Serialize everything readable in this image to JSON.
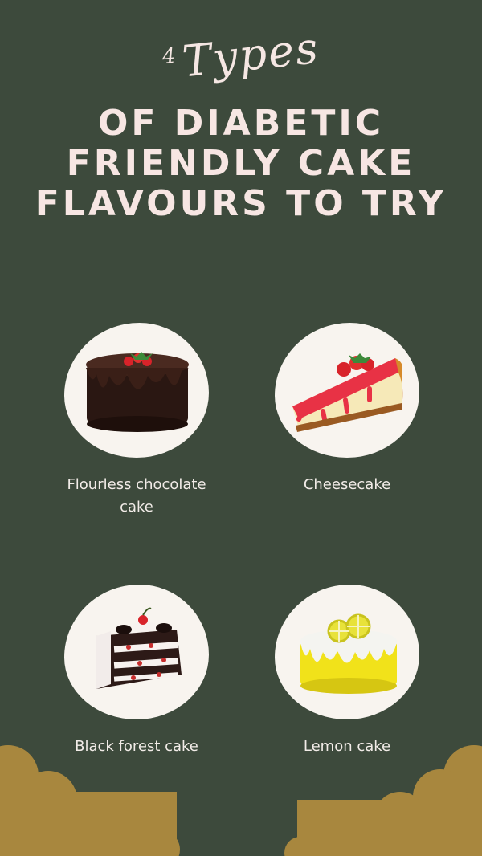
{
  "header": {
    "number": "4",
    "script": "Types",
    "line1": "OF DIABETIC",
    "line2": "FRIENDLY CAKE",
    "line3": "FLAVOURS TO TRY"
  },
  "cakes": [
    {
      "caption_line1": "Flourless chocolate",
      "caption_line2": "cake",
      "icon": "chocolate-cake-icon"
    },
    {
      "caption_line1": "Cheesecake",
      "caption_line2": "",
      "icon": "cheesecake-icon"
    },
    {
      "caption_line1": "Black forest cake",
      "caption_line2": "",
      "icon": "black-forest-cake-icon"
    },
    {
      "caption_line1": "Lemon cake",
      "caption_line2": "",
      "icon": "lemon-cake-icon"
    }
  ],
  "colors": {
    "background": "#3d4a3c",
    "title": "#f7e6e3",
    "circle": "#f8f4ef",
    "cloud": "#a8873e"
  }
}
